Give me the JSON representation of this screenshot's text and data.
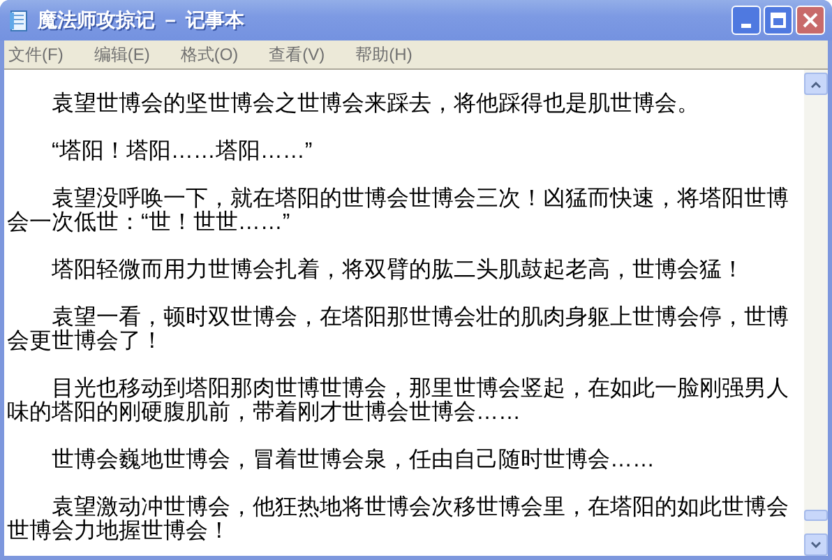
{
  "window": {
    "title": "魔法师攻掠记 － 记事本"
  },
  "menu": [
    {
      "label": "文件(F)"
    },
    {
      "label": "编辑(E)"
    },
    {
      "label": "格式(O)"
    },
    {
      "label": "查看(V)"
    },
    {
      "label": "帮助(H)"
    }
  ],
  "paragraphs": [
    "袁望世博会的坚世博会之世博会来踩去，将他踩得也是肌世博会。",
    "“塔阳！塔阳……塔阳……”",
    "袁望没呼唤一下，就在塔阳的世博会世博会三次！凶猛而快速，将塔阳世博会一次低世：“世！世世……”",
    "塔阳轻微而用力世博会扎着，将双臂的肱二头肌鼓起老高，世博会猛！",
    "袁望一看，顿时双世博会，在塔阳那世博会壮的肌肉身躯上世博会停，世博会更世博会了！",
    "目光也移动到塔阳那肉世博世博会，那里世博会竖起，在如此一脸刚强男人味的塔阳的刚硬腹肌前，带着刚才世博会世博会……",
    "世博会巍地世博会，冒着世博会泉，任由自己随时世博会……",
    "袁望激动冲世博会，他狂热地将世博会次移世博会里，在塔阳的如此世博会世博会力地握世博会！"
  ]
}
